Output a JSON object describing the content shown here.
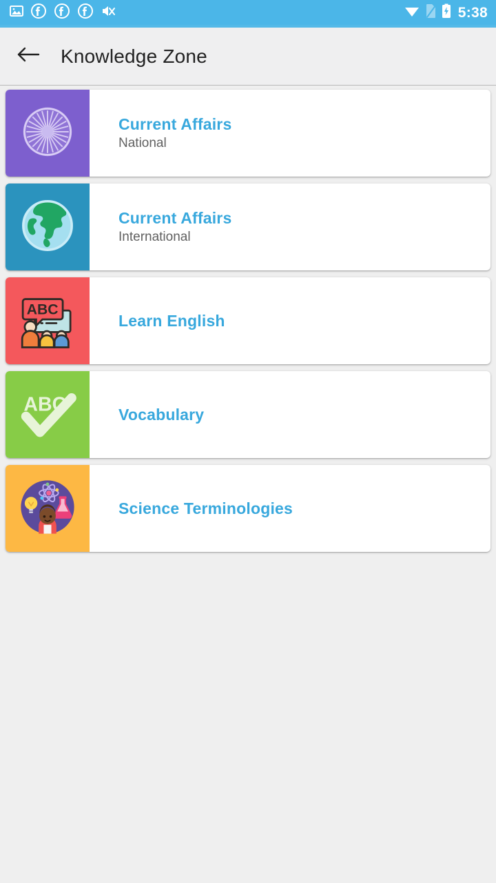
{
  "status_bar": {
    "background": "#4bb6e8",
    "time": "5:38",
    "left_icons": [
      {
        "name": "screenshot-image-icon"
      },
      {
        "name": "facebook-notification-icon-1"
      },
      {
        "name": "facebook-notification-icon-2"
      },
      {
        "name": "facebook-notification-icon-3"
      },
      {
        "name": "vibrate-mute-icon"
      }
    ],
    "right_icons": [
      {
        "name": "wifi-icon"
      },
      {
        "name": "sim-card-icon"
      },
      {
        "name": "battery-charging-icon"
      }
    ]
  },
  "appbar": {
    "back_label": "back-arrow",
    "title": "Knowledge Zone"
  },
  "colors": {
    "page_background": "#efefef",
    "card_background": "#ffffff",
    "title_blue": "#38a8dd",
    "subtitle_gray": "#616161",
    "appbar_background": "#efeff0"
  },
  "list": {
    "items": [
      {
        "title": "Current Affairs",
        "subtitle": "National",
        "icon": "ashoka-chakra-icon",
        "tile_color": "#7d5fce"
      },
      {
        "title": "Current Affairs",
        "subtitle": "International",
        "icon": "globe-earth-icon",
        "tile_color": "#2b93be"
      },
      {
        "title": "Learn English",
        "subtitle": "",
        "icon": "abc-classroom-icon",
        "tile_color": "#f4585c"
      },
      {
        "title": "Vocabulary",
        "subtitle": "",
        "icon": "abc-checkmark-icon",
        "tile_color": "#87cc47"
      },
      {
        "title": "Science Terminologies",
        "subtitle": "",
        "icon": "science-scientist-icon",
        "tile_color": "#fdb844"
      }
    ]
  }
}
